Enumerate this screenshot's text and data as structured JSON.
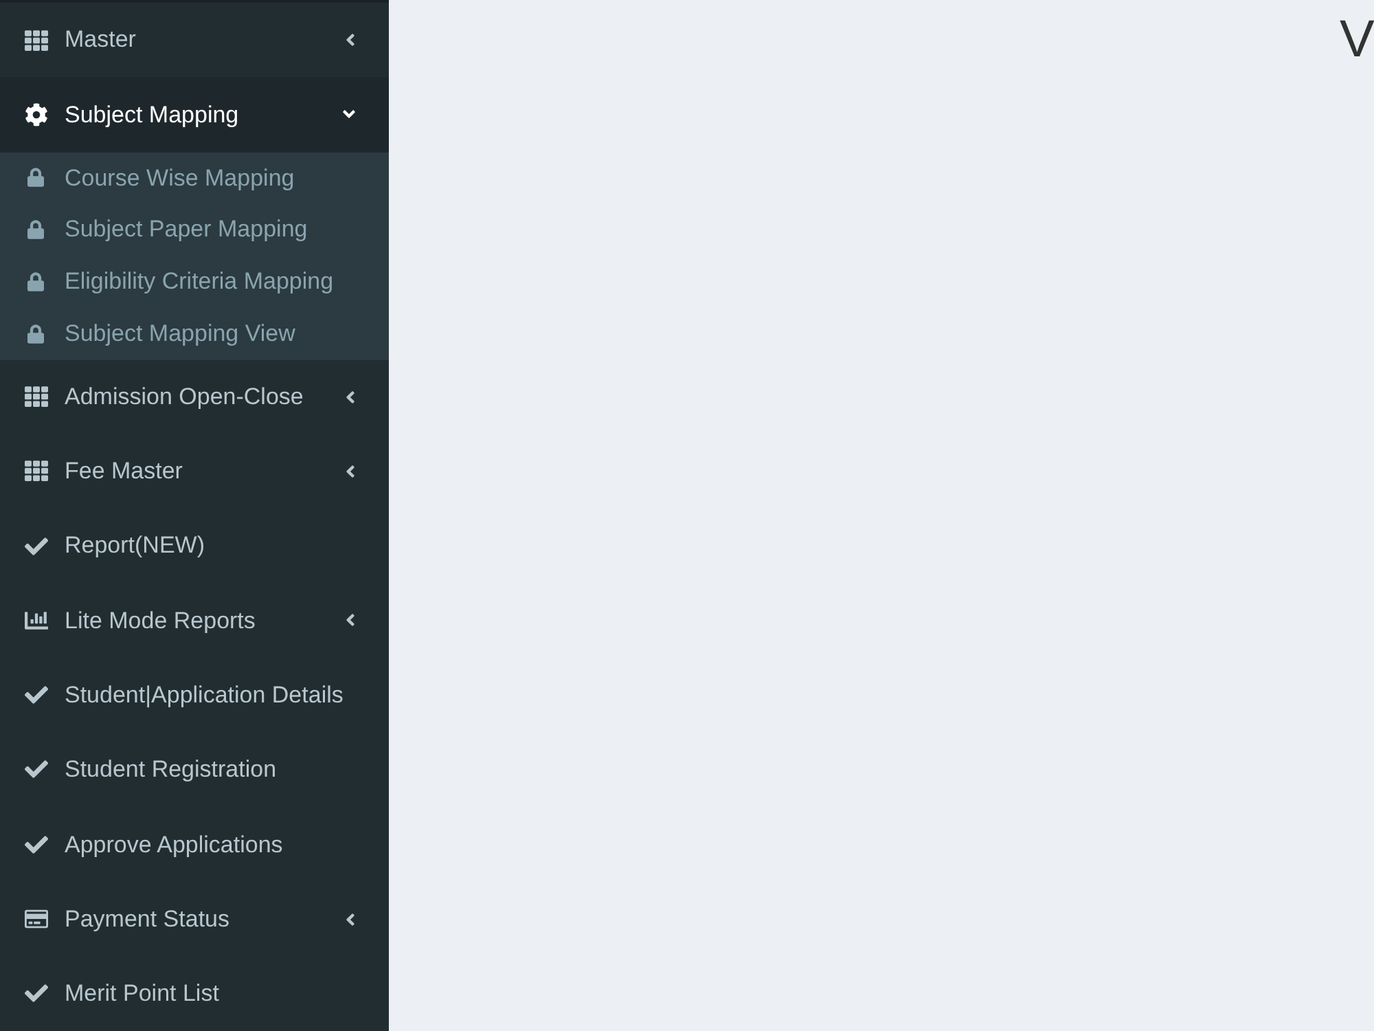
{
  "sidebar": {
    "items": [
      {
        "kind": "grid",
        "label": "Master",
        "expanded": false,
        "selected": false
      },
      {
        "kind": "gear",
        "label": "Subject Mapping",
        "expanded": true,
        "selected": true,
        "children": [
          {
            "label": "Course Wise Mapping",
            "selected": false
          },
          {
            "label": "Subject Paper Mapping",
            "selected": false
          },
          {
            "label": "Eligibility Criteria Mapping",
            "selected": false
          },
          {
            "label": "Subject Mapping View",
            "selected": false
          }
        ]
      },
      {
        "kind": "grid",
        "label": "Admission Open-Close",
        "expanded": false,
        "selected": false
      },
      {
        "kind": "grid",
        "label": "Fee Master",
        "expanded": false,
        "selected": false
      },
      {
        "kind": "check",
        "label": "Report(NEW)",
        "selected": false
      },
      {
        "kind": "chart",
        "label": "Lite Mode Reports",
        "expanded": false,
        "selected": false
      },
      {
        "kind": "check",
        "label": "Student|Application Details",
        "selected": false
      },
      {
        "kind": "check",
        "label": "Student Registration",
        "selected": false
      },
      {
        "kind": "check",
        "label": "Approve Applications",
        "selected": false
      },
      {
        "kind": "card",
        "label": "Payment Status",
        "expanded": false,
        "selected": false
      },
      {
        "kind": "check",
        "label": "Merit Point List",
        "selected": false
      }
    ]
  },
  "main": {
    "heading": "V"
  }
}
